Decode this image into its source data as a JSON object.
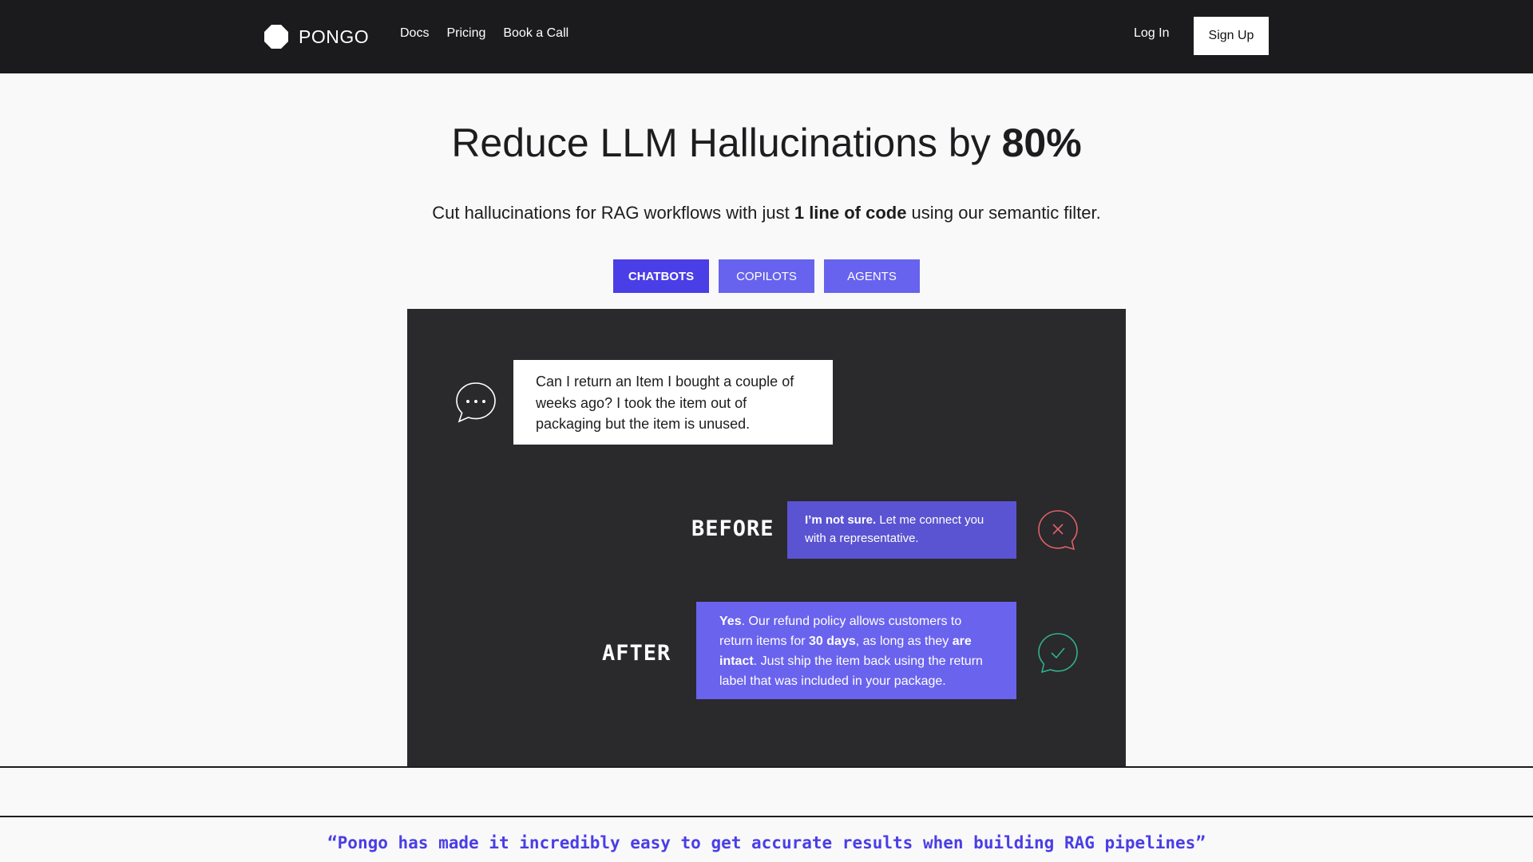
{
  "nav": {
    "brand": "PONGO",
    "links": [
      "Docs",
      "Pricing",
      "Book a Call"
    ],
    "login": "Log In",
    "signup": "Sign Up"
  },
  "hero": {
    "title_prefix": "Reduce LLM Hallucinations by ",
    "title_highlight": "80%",
    "subtitle_before": "Cut hallucinations for RAG workflows with just ",
    "subtitle_bold": "1 line of code",
    "subtitle_after": " using our semantic filter."
  },
  "tabs": [
    {
      "label": "CHATBOTS",
      "active": true
    },
    {
      "label": "COPILOTS",
      "active": false
    },
    {
      "label": "AGENTS",
      "active": false
    }
  ],
  "demo": {
    "question": "Can I return an Item I bought a couple of weeks ago? I took the item out of packaging but the item is unused.",
    "before_label": "BEFORE",
    "before_bold": "I’m not sure.",
    "before_rest": " Let me connect you with a representative.",
    "after_label": "AFTER",
    "after_bold1": "Yes",
    "after_text1": ". Our refund policy allows customers to return items for ",
    "after_bold2": "30 days",
    "after_text2": ", as long as they ",
    "after_bold3": "are intact",
    "after_text3": ". Just ship the item back using the return label that was included in your package."
  },
  "quote": "“Pongo has made it incredibly easy to get accurate results when building RAG pipelines”",
  "colors": {
    "nav_bg": "#1b1a1c",
    "accent": "#4a3ee6",
    "tab_inactive": "#6763ee",
    "panel_bg": "#2a292c",
    "error": "#e0606a",
    "success": "#2fb38a"
  },
  "icons": [
    "pongo-logo-icon",
    "chat-dots-icon",
    "x-circle-icon",
    "check-circle-icon"
  ]
}
